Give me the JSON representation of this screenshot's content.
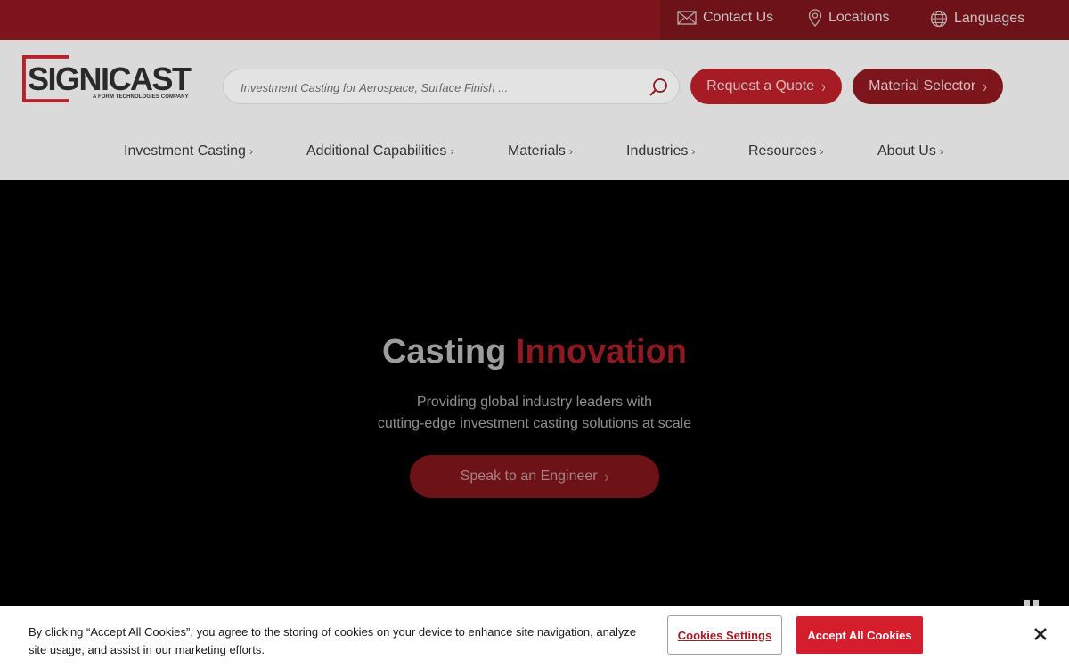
{
  "utility_bar": {
    "contact": "Contact Us",
    "locations": "Locations",
    "languages": "Languages"
  },
  "brand": {
    "name": "SIGNICAST",
    "tagline": "A FORM TECHNOLOGIES COMPANY"
  },
  "search": {
    "placeholder": "Investment Casting for Aerospace, Surface Finish ..."
  },
  "header_buttons": {
    "quote": "Request a Quote",
    "material": "Material Selector"
  },
  "nav": {
    "items": [
      {
        "label": "Investment Casting"
      },
      {
        "label": "Additional Capabilities"
      },
      {
        "label": "Materials"
      },
      {
        "label": "Industries"
      },
      {
        "label": "Resources"
      },
      {
        "label": "About Us"
      }
    ]
  },
  "hero": {
    "title_part1": "Casting",
    "title_part2": "Innovation",
    "subtitle_line1": "Providing global industry leaders with",
    "subtitle_line2": "cutting-edge investment casting solutions at scale",
    "cta": "Speak to an Engineer"
  },
  "cookie_banner": {
    "text": "By clicking “Accept All Cookies”, you agree to the storing of cookies on your device to enhance site navigation, analyze site usage, and assist in our marketing efforts.",
    "settings_label": "Cookies Settings",
    "accept_label": "Accept All Cookies"
  },
  "colors": {
    "brand_red": "#a51c24",
    "accept_red": "#d41e2b"
  }
}
